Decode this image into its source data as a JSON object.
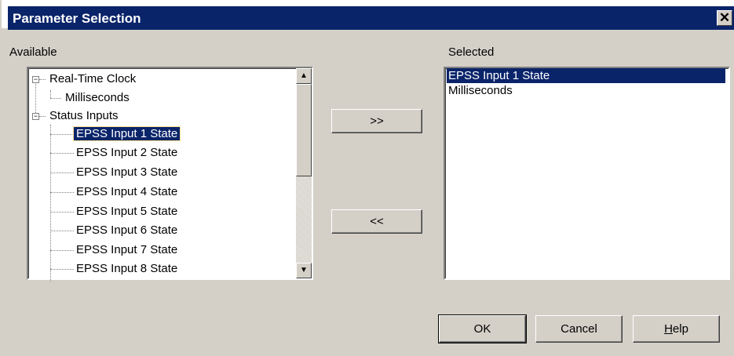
{
  "window": {
    "title": "Parameter Selection",
    "close_glyph": "✕"
  },
  "available": {
    "label": "Available",
    "tree": [
      {
        "label": "Real-Time Clock",
        "expander": "−",
        "children": [
          {
            "label": "Milliseconds"
          }
        ]
      },
      {
        "label": "Status Inputs",
        "expander": "−",
        "children": [
          {
            "label": "EPSS Input 1 State",
            "selected": true
          },
          {
            "label": "EPSS Input 2 State"
          },
          {
            "label": "EPSS Input 3 State"
          },
          {
            "label": "EPSS Input 4 State"
          },
          {
            "label": "EPSS Input 5 State"
          },
          {
            "label": "EPSS Input 6 State"
          },
          {
            "label": "EPSS Input 7 State"
          },
          {
            "label": "EPSS Input 8 State"
          }
        ]
      }
    ]
  },
  "selected": {
    "label": "Selected",
    "items": [
      {
        "label": "EPSS Input 1 State",
        "selected": true
      },
      {
        "label": "Milliseconds"
      }
    ]
  },
  "buttons": {
    "add": ">>",
    "remove": "<<",
    "ok": "OK",
    "cancel": "Cancel",
    "help_h": "H",
    "help_rest": "elp"
  },
  "icons": {
    "scroll_up": "scroll-up-arrow-icon",
    "scroll_down": "scroll-down-arrow-icon",
    "close": "close-icon"
  },
  "colors": {
    "selection": "#0a246a",
    "dialog_bg": "#d4d0c8"
  }
}
